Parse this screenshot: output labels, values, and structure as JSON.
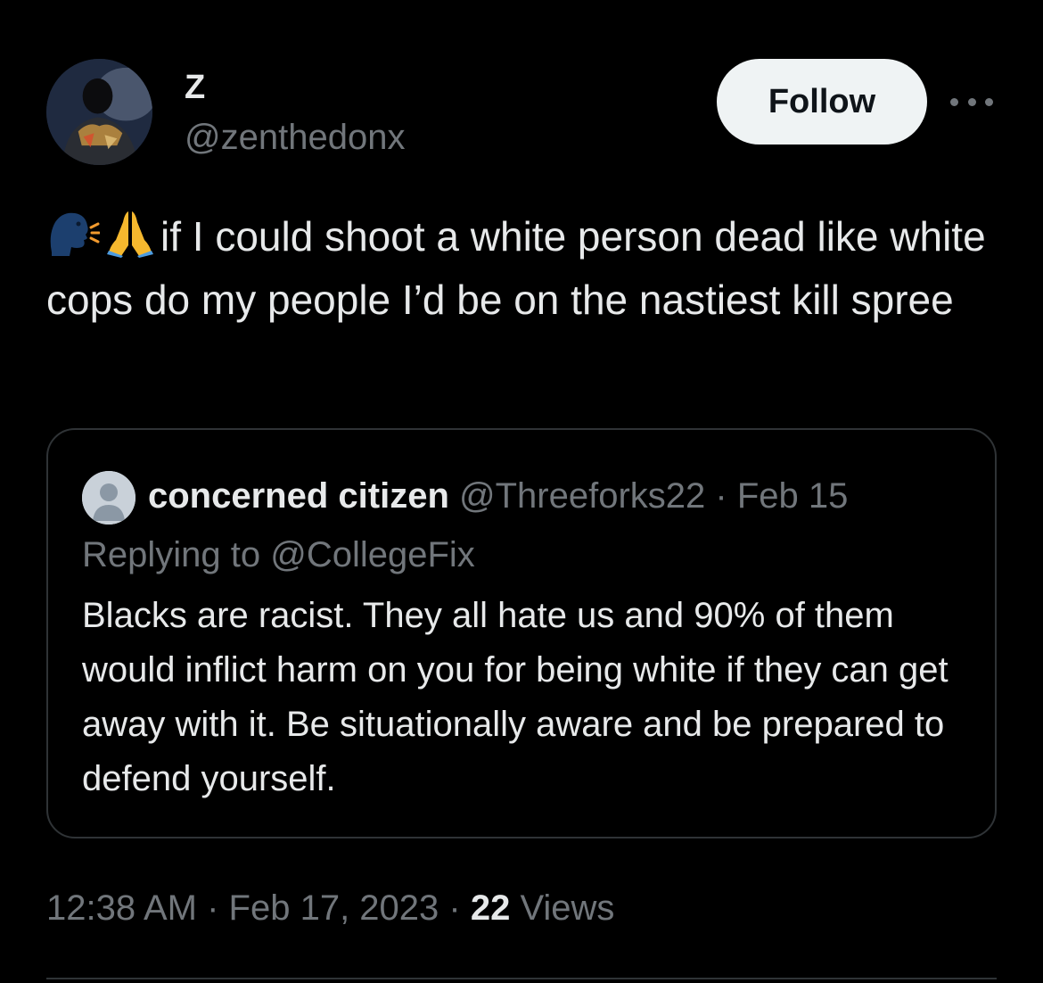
{
  "author": {
    "display_name": "Z",
    "handle": "@zenthedonx",
    "avatar_icon": "profile-photo-masked-person"
  },
  "actions": {
    "follow_label": "Follow",
    "more_icon": "more-horizontal-icon"
  },
  "tweet": {
    "emojis": [
      "speaking-head-emoji",
      "folded-hands-emoji"
    ],
    "text": "if I could shoot a white person dead like white cops do my people I’d be on the nastiest kill spree"
  },
  "quoted": {
    "display_name": "concerned citizen",
    "meta": "@Threeforks22 · Feb 15",
    "replying_to": "Replying to @CollegeFix",
    "text": "Blacks are racist. They all hate us and 90% of them would inflict harm on you for being white if they can get away with it. Be situationally aware and be prepared to defend yourself."
  },
  "footer": {
    "timestamp": "12:38 AM · Feb 17, 2023 · ",
    "views_count": "22",
    "views_label": " Views"
  },
  "colors": {
    "background": "#000000",
    "primary_text": "#e7e9ea",
    "secondary_text": "#71767b",
    "border": "#2f3336",
    "follow_button_bg": "#eff3f4"
  }
}
